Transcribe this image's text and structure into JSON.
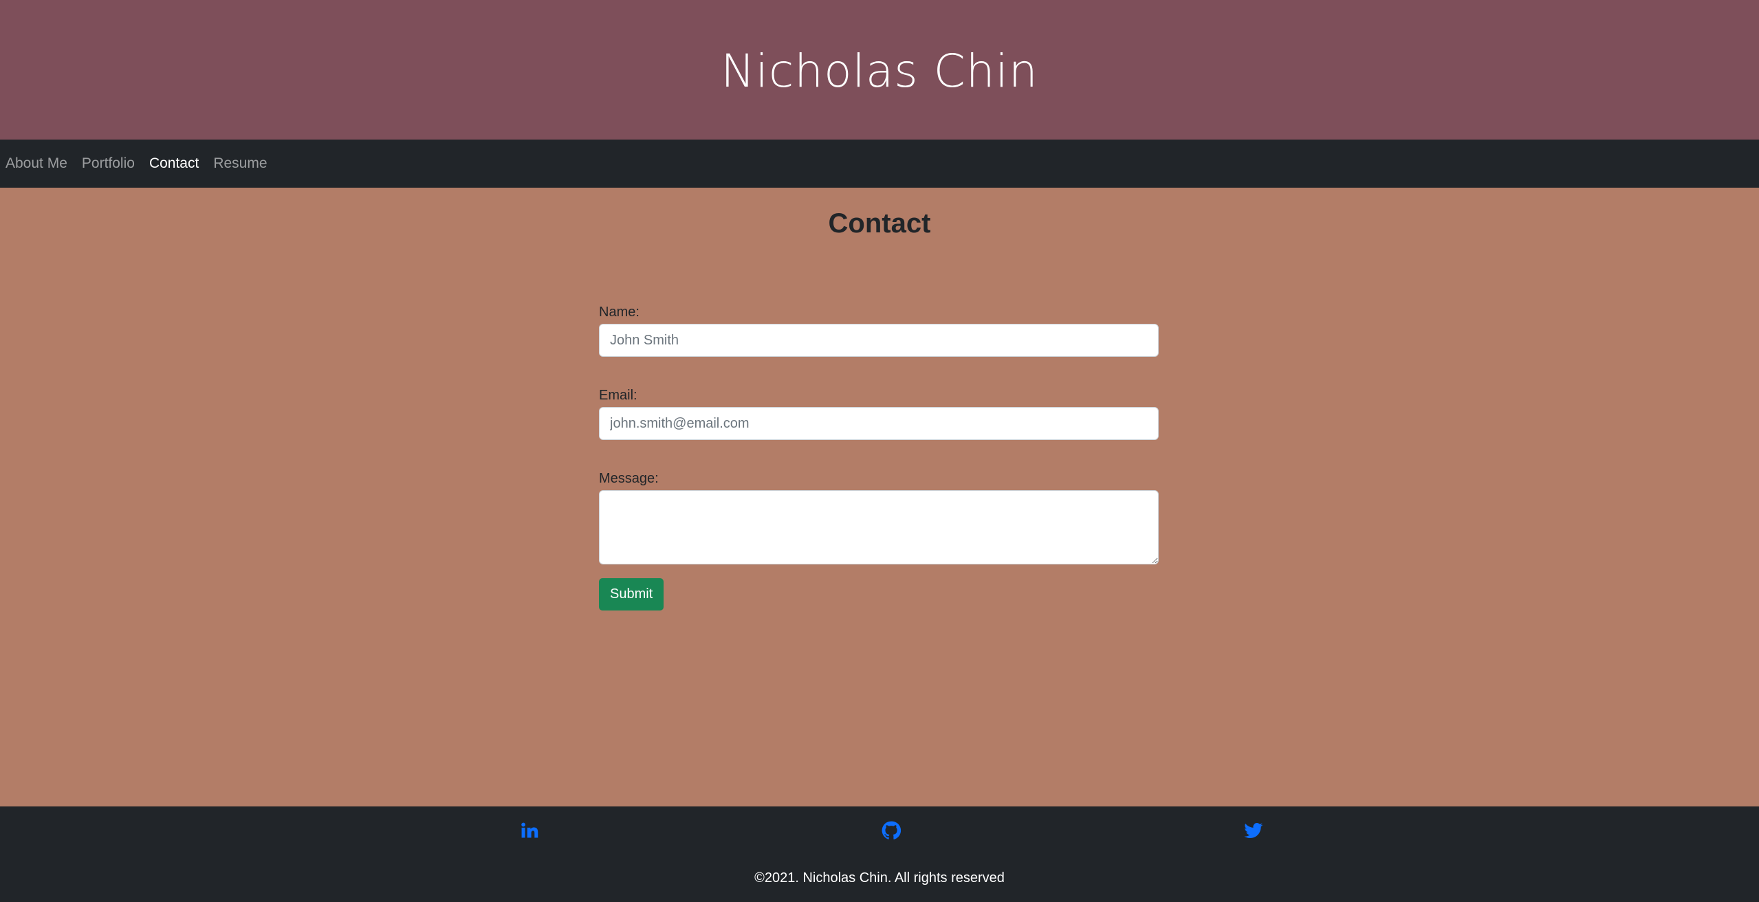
{
  "header": {
    "title": "Nicholas Chin"
  },
  "nav": {
    "items": [
      {
        "label": "About Me",
        "active": false
      },
      {
        "label": "Portfolio",
        "active": false
      },
      {
        "label": "Contact",
        "active": true
      },
      {
        "label": "Resume",
        "active": false
      }
    ]
  },
  "main": {
    "title": "Contact",
    "form": {
      "name_label": "Name:",
      "name_placeholder": "John Smith",
      "email_label": "Email:",
      "email_placeholder": "john.smith@email.com",
      "message_label": "Message:",
      "message_value": "",
      "submit_label": "Submit"
    }
  },
  "footer": {
    "icons": [
      "linkedin-icon",
      "github-icon",
      "twitter-icon"
    ],
    "copyright": "©2021. Nicholas Chin. All rights reserved"
  },
  "colors": {
    "header_bg": "#7e4f5a",
    "nav_bg": "#212529",
    "main_bg": "#b37d67",
    "button_bg": "#198754",
    "icon_color": "#0d6efd"
  }
}
